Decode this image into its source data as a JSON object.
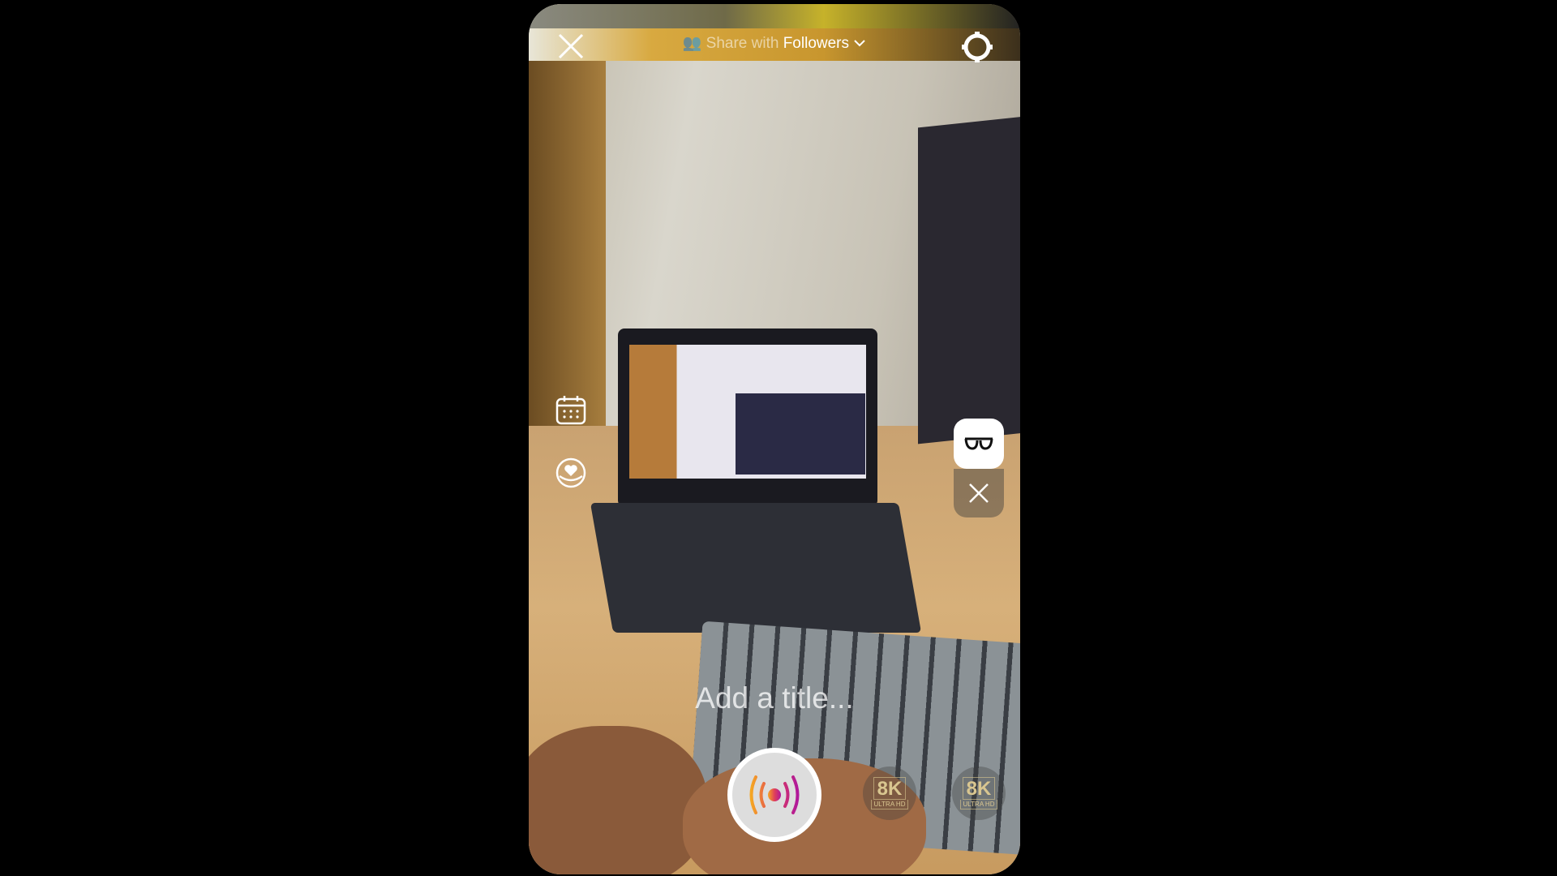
{
  "header": {
    "close_icon": "close-icon",
    "audience_prefix": "Share with",
    "audience_value": "Followers",
    "audience_icon": "people-icon",
    "settings_icon": "gear-icon"
  },
  "side_tools": {
    "schedule_icon": "calendar-icon",
    "fundraiser_icon": "heart-circle-icon"
  },
  "effects": {
    "active_effect_icon": "glasses-icon",
    "remove_effect_icon": "close-icon"
  },
  "title_input": {
    "placeholder": "Add a title..."
  },
  "record_button": {
    "icon": "live-broadcast-icon"
  },
  "quality_badges": [
    {
      "label": "8K",
      "sub": "ULTRA HD"
    },
    {
      "label": "8K",
      "sub": "ULTRA HD"
    }
  ]
}
